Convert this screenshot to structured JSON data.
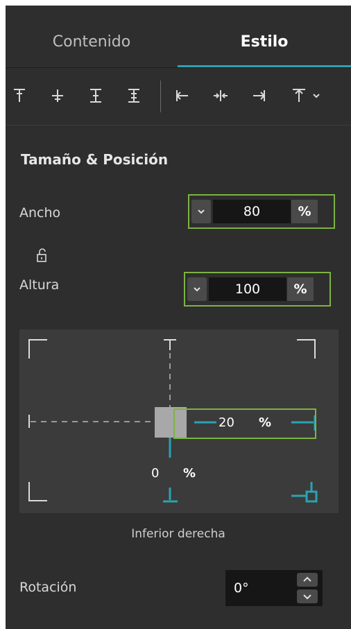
{
  "tabs": [
    {
      "label": "Contenido",
      "active": false
    },
    {
      "label": "Estilo",
      "active": true
    }
  ],
  "toolbar": {
    "icons": [
      "align-top-icon",
      "align-middle-icon",
      "align-bottom-icon",
      "align-stretch-icon",
      "align-left-icon",
      "align-center-icon",
      "align-right-icon",
      "align-top-dropdown-icon"
    ]
  },
  "section": {
    "title": "Tamaño & Posición"
  },
  "width_field": {
    "label": "Ancho",
    "value": "80",
    "unit": "%"
  },
  "height_field": {
    "label": "Altura",
    "value": "100",
    "unit": "%"
  },
  "position": {
    "horizontal_value": "20",
    "horizontal_unit": "%",
    "vertical_value": "0",
    "vertical_unit": "%",
    "anchor_label": "Inferior derecha"
  },
  "rotation": {
    "label": "Rotación",
    "value": "0°"
  },
  "colors": {
    "accent": "#2aa3b3",
    "highlight": "#7cb342",
    "panel": "#2e2e2e"
  }
}
